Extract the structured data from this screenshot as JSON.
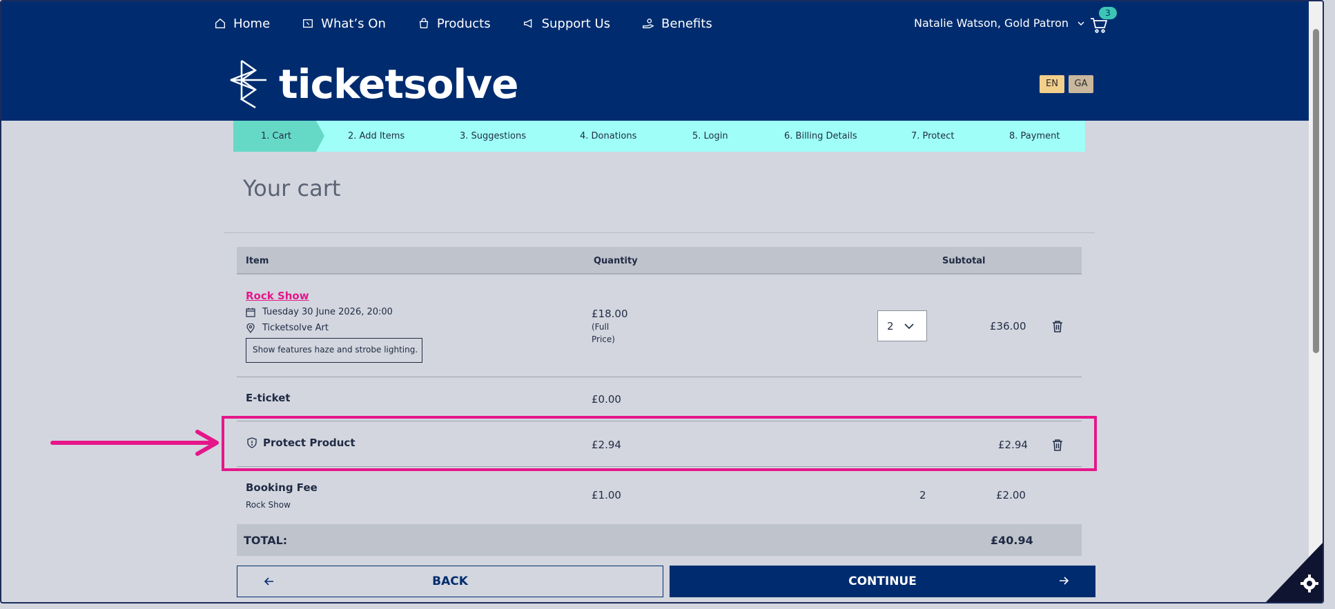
{
  "nav": {
    "items": [
      {
        "label": "Home",
        "icon": "home-icon"
      },
      {
        "label": "What’s On",
        "icon": "ticket-icon"
      },
      {
        "label": "Products",
        "icon": "shopping-bag-icon"
      },
      {
        "label": "Support Us",
        "icon": "megaphone-icon"
      },
      {
        "label": "Benefits",
        "icon": "hand-coin-icon"
      }
    ],
    "user": "Natalie Watson, Gold Patron",
    "cart_count": "3"
  },
  "brand": {
    "name": "ticketsolve"
  },
  "languages": [
    "EN",
    "GA"
  ],
  "steps": [
    "1. Cart",
    "2. Add Items",
    "3. Suggestions",
    "4. Donations",
    "5. Login",
    "6. Billing Details",
    "7. Protect",
    "8. Payment"
  ],
  "cart": {
    "title": "Your cart",
    "columns": {
      "item": "Item",
      "quantity": "Quantity",
      "subtotal": "Subtotal"
    },
    "rows": {
      "show": {
        "name": "Rock Show",
        "date": "Tuesday 30 June 2026, 20:00",
        "venue": "Ticketsolve Art",
        "note": "Show features haze and strobe lighting.",
        "price": "£18.00",
        "price_type_1": "(Full",
        "price_type_2": "Price)",
        "qty": "2",
        "subtotal": "£36.00"
      },
      "eticket": {
        "name": "E-ticket",
        "price": "£0.00"
      },
      "protect": {
        "name": "Protect Product",
        "price": "£2.94",
        "subtotal": "£2.94"
      },
      "booking": {
        "name": "Booking Fee",
        "sub": "Rock Show",
        "price": "£1.00",
        "qty": "2",
        "subtotal": "£2.00"
      }
    },
    "total_label": "TOTAL:",
    "total_value": "£40.94"
  },
  "buttons": {
    "back": "BACK",
    "continue": "CONTINUE"
  },
  "colors": {
    "primary": "#002c6f",
    "accent": "#e5168a",
    "steps_bg": "#9ffff8",
    "step_active": "#66d9c6"
  }
}
